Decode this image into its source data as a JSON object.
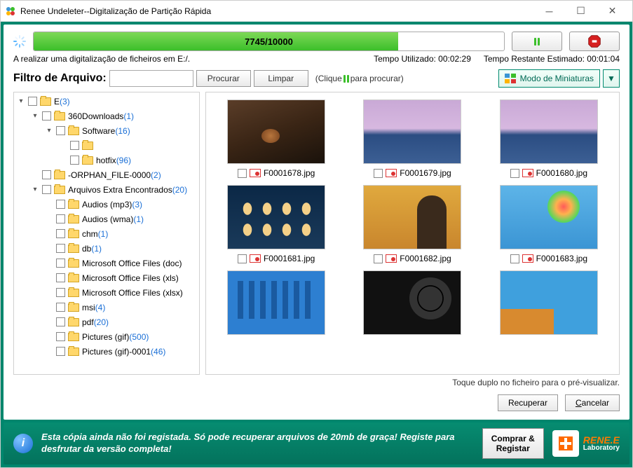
{
  "window": {
    "title": "Renee Undeleter--Digitalização de Partição Rápida"
  },
  "progress": {
    "text": "7745/10000",
    "percent": 77.45
  },
  "status": {
    "scanning": "A realizar uma digitalização de ficheiros em E:/.",
    "time_used_label": "Tempo Utilizado: 00:02:29",
    "time_remain_label": "Tempo Restante Estimado: 00:01:04"
  },
  "filter": {
    "label": "Filtro de Arquivo:",
    "value": "",
    "search_btn": "Procurar",
    "clear_btn": "Limpar",
    "hint_before": "(Clique",
    "hint_after": "para procurar)"
  },
  "viewmode": {
    "label": "Modo de Miniaturas"
  },
  "tree": [
    {
      "depth": 0,
      "arrow": "▾",
      "name": "E",
      "count": "(3)"
    },
    {
      "depth": 1,
      "arrow": "▾",
      "name": "360Downloads",
      "count": "(1)"
    },
    {
      "depth": 2,
      "arrow": "▾",
      "name": "Software",
      "count": "(16)"
    },
    {
      "depth": 3,
      "arrow": "",
      "name": "",
      "count": ""
    },
    {
      "depth": 3,
      "arrow": "",
      "name": "hotfix",
      "count": "(96)"
    },
    {
      "depth": 1,
      "arrow": "",
      "name": "-ORPHAN_FILE-0000",
      "count": "(2)"
    },
    {
      "depth": 1,
      "arrow": "▾",
      "name": "Arquivos Extra Encontrados",
      "count": "(20)"
    },
    {
      "depth": 2,
      "arrow": "",
      "name": "Audios (mp3)",
      "count": "(3)"
    },
    {
      "depth": 2,
      "arrow": "",
      "name": "Audios (wma)",
      "count": "(1)"
    },
    {
      "depth": 2,
      "arrow": "",
      "name": "chm",
      "count": "(1)"
    },
    {
      "depth": 2,
      "arrow": "",
      "name": "db",
      "count": "(1)"
    },
    {
      "depth": 2,
      "arrow": "",
      "name": "Microsoft Office Files (doc)",
      "count": ""
    },
    {
      "depth": 2,
      "arrow": "",
      "name": "Microsoft Office Files (xls)",
      "count": ""
    },
    {
      "depth": 2,
      "arrow": "",
      "name": "Microsoft Office Files (xlsx)",
      "count": ""
    },
    {
      "depth": 2,
      "arrow": "",
      "name": "msi",
      "count": "(4)"
    },
    {
      "depth": 2,
      "arrow": "",
      "name": "pdf",
      "count": "(20)"
    },
    {
      "depth": 2,
      "arrow": "",
      "name": "Pictures (gif)",
      "count": "(500)"
    },
    {
      "depth": 2,
      "arrow": "",
      "name": "Pictures (gif)-0001",
      "count": "(46)"
    }
  ],
  "thumbs": [
    {
      "file": "F0001678.jpg",
      "cls": "th1"
    },
    {
      "file": "F0001679.jpg",
      "cls": "th2"
    },
    {
      "file": "F0001680.jpg",
      "cls": "th3"
    },
    {
      "file": "F0001681.jpg",
      "cls": "th4"
    },
    {
      "file": "F0001682.jpg",
      "cls": "th5"
    },
    {
      "file": "F0001683.jpg",
      "cls": "th6"
    },
    {
      "file": "",
      "cls": "th7"
    },
    {
      "file": "",
      "cls": "th8"
    },
    {
      "file": "",
      "cls": "th9"
    }
  ],
  "footnote": "Toque duplo no ficheiro para o pré-visualizar.",
  "actions": {
    "recover": "Recuperar",
    "cancel": "Cancelar",
    "cancel_u": "C"
  },
  "banner": {
    "text": "Esta cópia ainda não foi registada. Só pode recuperar arquivos de 20mb de graça! Registe para desfrutar da versão completa!",
    "buy1": "Comprar &",
    "buy2": "Registar",
    "logo1": "RENE.E",
    "logo2": "Laboratory"
  }
}
